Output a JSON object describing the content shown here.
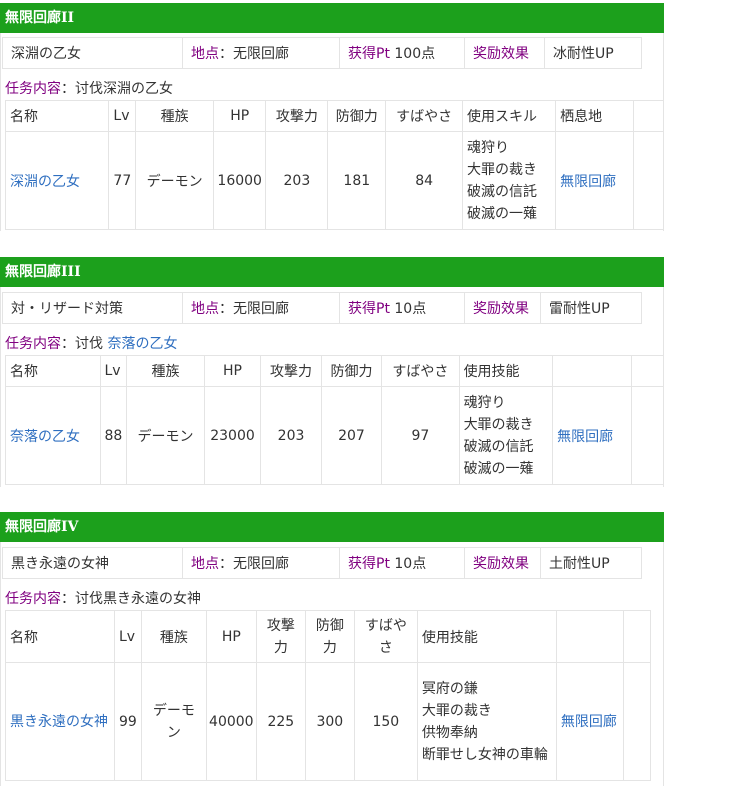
{
  "sections": [
    {
      "title": "無限回廊II",
      "info": {
        "target": "深淵の乙女",
        "location_label": "地点",
        "location_value": "：无限回廊",
        "points_label": "获得Pt",
        "points_value": " 100点",
        "reward_label": "奖励效果",
        "reward_value": "冰耐性UP"
      },
      "mission_label": "任务内容",
      "mission_prefix": "：讨伐深淵の乙女",
      "mission_link": "",
      "headers": [
        "名称",
        "Lv",
        "種族",
        "HP",
        "攻撃力",
        "防御力",
        "すばやさ",
        "使用スキル",
        "栖息地"
      ],
      "monster": {
        "name": "深淵の乙女",
        "lv": "77",
        "race": "デーモン",
        "hp": "16000",
        "atk": "203",
        "def": "181",
        "spd": "84",
        "skills": [
          "魂狩り",
          "大罪の裁き",
          "破滅の信託",
          "破滅の一薙"
        ],
        "habitat": "無限回廊"
      }
    },
    {
      "title": "無限回廊III",
      "info": {
        "target": "対・リザード対策",
        "location_label": "地点",
        "location_value": "：无限回廊",
        "points_label": "获得Pt",
        "points_value": " 10点",
        "reward_label": "奖励效果",
        "reward_value": "雷耐性UP"
      },
      "mission_label": "任务内容",
      "mission_prefix": "：讨伐 ",
      "mission_link": "奈落の乙女",
      "headers": [
        "名称",
        "Lv",
        "種族",
        "HP",
        "攻撃力",
        "防御力",
        "すばやさ",
        "使用技能",
        ""
      ],
      "monster": {
        "name": "奈落の乙女",
        "lv": "88",
        "race": "デーモン",
        "hp": "23000",
        "atk": "203",
        "def": "207",
        "spd": "97",
        "skills": [
          "魂狩り",
          "大罪の裁き",
          "破滅の信託",
          "破滅の一薙"
        ],
        "habitat": "無限回廊"
      }
    },
    {
      "title": "無限回廊IV",
      "info": {
        "target": "黒き永遠の女神",
        "location_label": "地点",
        "location_value": "：无限回廊",
        "points_label": "获得Pt",
        "points_value": " 10点",
        "reward_label": "奖励效果",
        "reward_value": "土耐性UP"
      },
      "mission_label": "任务内容",
      "mission_prefix": "：讨伐黒き永遠の女神",
      "mission_link": "",
      "headers": [
        "名称",
        "Lv",
        "種族",
        "HP",
        "攻撃\n力",
        "防御\n力",
        "すばや\nさ",
        "使用技能",
        ""
      ],
      "monster": {
        "name": "黒き永遠の女神",
        "lv": "99",
        "race": "デーモン",
        "hp": "40000",
        "atk": "225",
        "def": "300",
        "spd": "150",
        "skills": [
          "冥府の鎌",
          "大罪の裁き",
          "供物奉納",
          "断罪せし女神の車輪"
        ],
        "habitat": "無限回廊"
      }
    }
  ]
}
